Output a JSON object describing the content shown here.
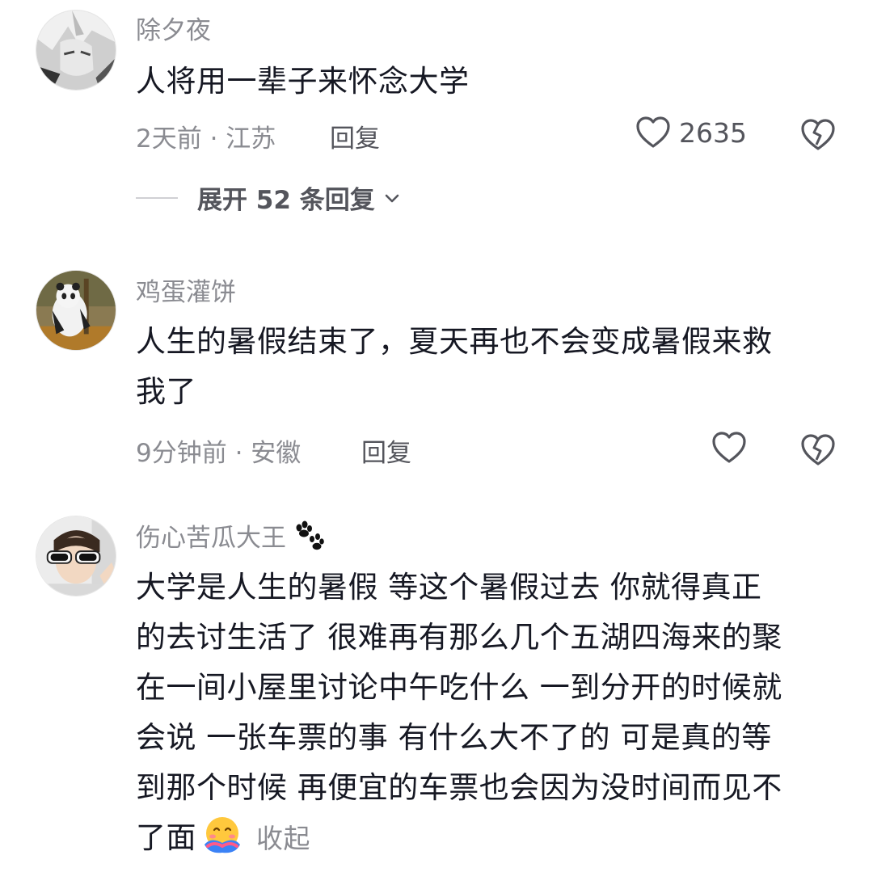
{
  "comments": [
    {
      "username": "除夕夜",
      "content": "人将用一辈子来怀念大学",
      "meta": "2天前 · 江苏",
      "reply_label": "回复",
      "likes": "2635",
      "expand_label": "展开 52 条回复",
      "avatar_icon": "anime-avatar"
    },
    {
      "username": "鸡蛋灌饼",
      "content_lines": [
        "人生的暑假结束了，夏天再也不会变成暑假来救",
        "我了"
      ],
      "meta": "9分钟前 · 安徽",
      "reply_label": "回复",
      "avatar_icon": "panda-avatar"
    },
    {
      "username": "伤心苦瓜大王",
      "username_badge_icon": "paw-prints-icon",
      "content_lines": [
        "大学是人生的暑假 等这个暑假过去 你就得真正",
        "的去讨生活了 很难再有那么几个五湖四海来的聚",
        "在一间小屋里讨论中午吃什么 一到分开的时候就",
        "会说 一张车票的事 有什么大不了的 可是真的等",
        "到那个时候 再便宜的车票也会因为没时间而见不",
        "了面"
      ],
      "collapse_label": "收起",
      "emoji_icon": "hugging-emoji",
      "avatar_icon": "person-sunglasses-avatar"
    }
  ],
  "icons": {
    "like": "heart-outline-icon",
    "dislike": "broken-heart-icon",
    "expand": "chevron-down-icon"
  }
}
